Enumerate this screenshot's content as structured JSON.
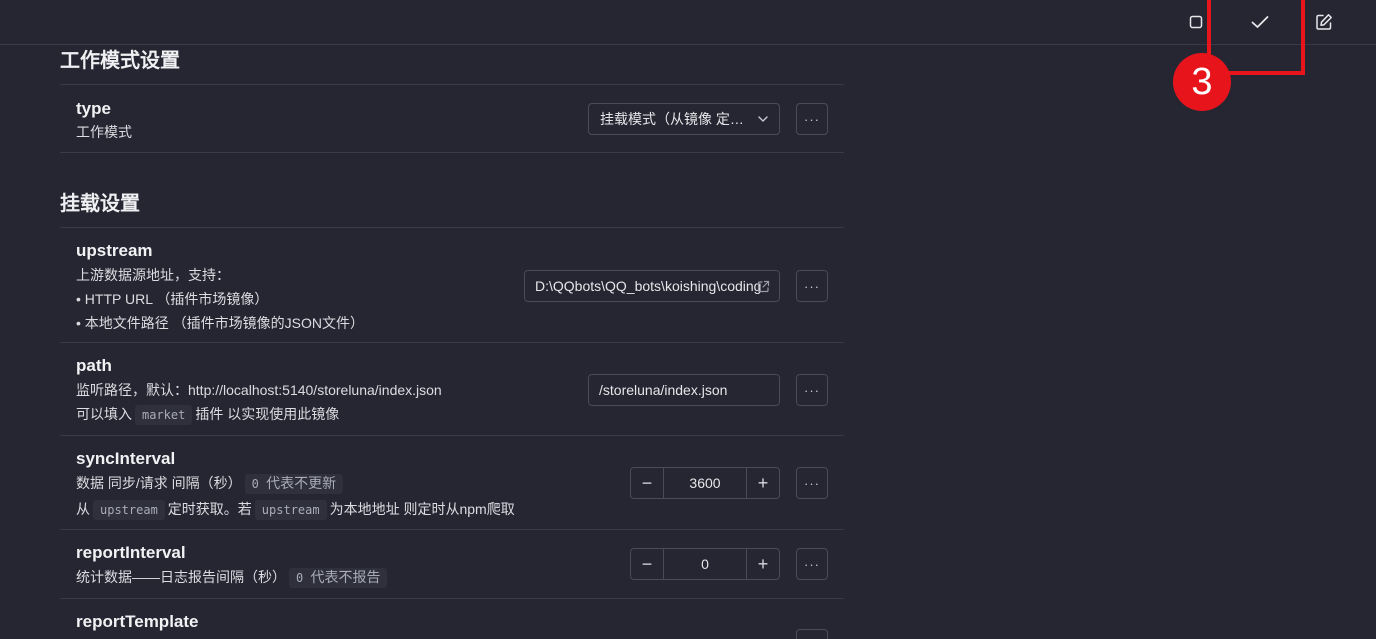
{
  "marker": {
    "number": "3"
  },
  "sections": [
    {
      "title": "工作模式设置"
    },
    {
      "title": "挂载设置"
    }
  ],
  "rows": {
    "type": {
      "name": "type",
      "desc": "工作模式",
      "select_value": "挂载模式（从镜像 定时获取）",
      "more": "···"
    },
    "upstream": {
      "name": "upstream",
      "desc_line1": "上游数据源地址，支持：",
      "desc_line2": "• HTTP URL （插件市场镜像）",
      "desc_line3": "• 本地文件路径 （插件市场镜像的JSON文件）",
      "value": "D:\\QQbots\\QQ_bots\\koishing\\coding",
      "more": "···"
    },
    "path": {
      "name": "path",
      "desc_line1": "监听路径，默认：http://localhost:5140/storeluna/index.json",
      "desc_line2_pre": "可以填入",
      "desc_line2_code": "market",
      "desc_line2_post": "插件 以实现使用此镜像",
      "value": "/storeluna/index.json",
      "more": "···"
    },
    "syncInterval": {
      "name": "syncInterval",
      "desc_line1_pre": "数据 同步/请求 间隔（秒）",
      "desc_line1_code": "0",
      "desc_line1_code_post": "代表不更新",
      "desc_line2_pre": "从",
      "desc_line2_code1": "upstream",
      "desc_line2_mid": "定时获取。若",
      "desc_line2_code2": "upstream",
      "desc_line2_post": "为本地地址 则定时从npm爬取",
      "value": "3600",
      "minus": "−",
      "plus": "+",
      "more": "···"
    },
    "reportInterval": {
      "name": "reportInterval",
      "desc_pre": "统计数据——日志报告间隔（秒）",
      "desc_code": "0",
      "desc_code_post": "代表不报告",
      "value": "0",
      "minus": "−",
      "plus": "+",
      "more": "···"
    },
    "reportTemplate": {
      "name": "reportTemplate",
      "more": "···"
    }
  }
}
